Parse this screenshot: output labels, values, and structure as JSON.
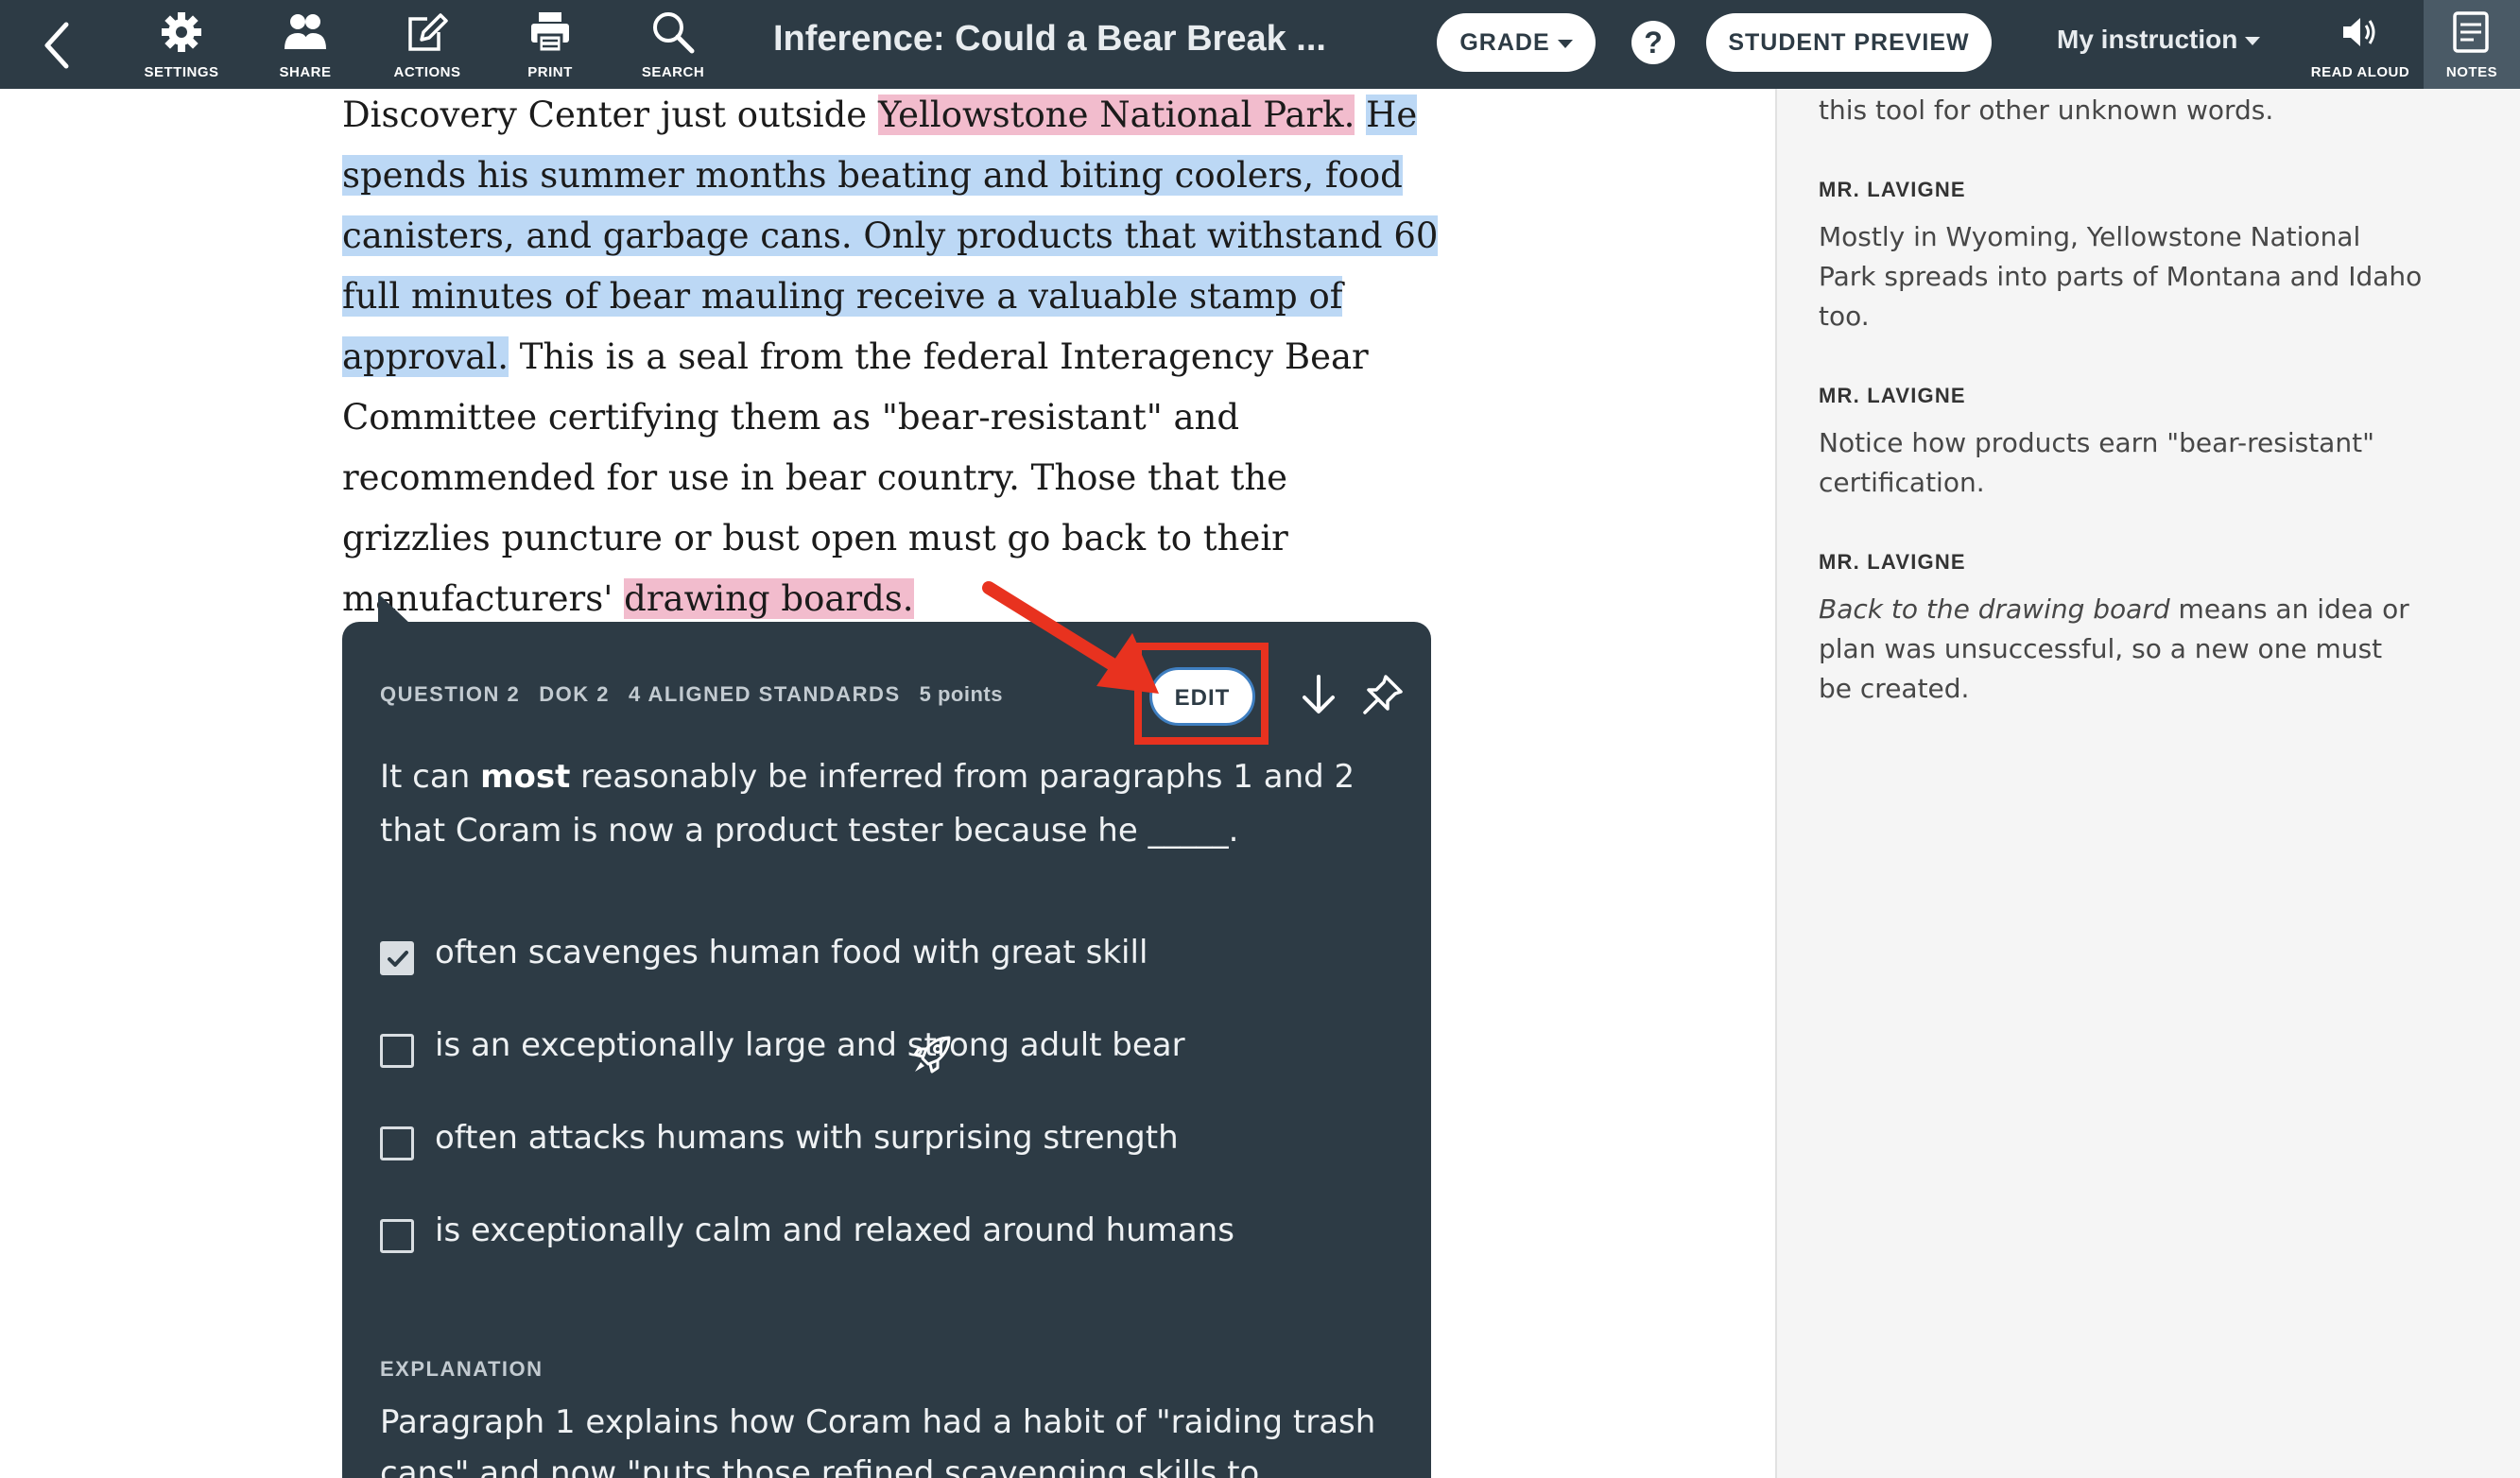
{
  "toolbar": {
    "back_icon": "chevron-left-icon",
    "settings_label": "SETTINGS",
    "share_label": "SHARE",
    "actions_label": "ACTIONS",
    "print_label": "PRINT",
    "search_label": "SEARCH",
    "title": "Inference: Could a Bear Break ...",
    "grade_label": "GRADE",
    "help_label": "?",
    "student_preview_label": "STUDENT PREVIEW",
    "instruction_select": "My instruction",
    "read_aloud_label": "READ ALOUD",
    "notes_label": "NOTES",
    "colors": {
      "bar": "#2d3b45",
      "pill": "#ffffff"
    }
  },
  "reading": {
    "part1": "Discovery Center just outside ",
    "hl1": "Yellowstone National Park.",
    "part2": " ",
    "hl2": "He spends his summer months beating and biting coolers, food canisters, and garbage cans. Only products that withstand 60 full minutes of bear mauling receive a valuable stamp of approval.",
    "part3": " This is a seal from the federal Interagency Bear Committee certifying them as \"bear-resistant\" and recommended for use in bear country. Those that the grizzlies puncture or bust open must go back to their manufacturers' ",
    "hl3": "drawing boards.",
    "highlight_colors": {
      "pink": "#f2bccd",
      "blue": "#bcd8f5"
    }
  },
  "question": {
    "number": "QUESTION 2",
    "dok": "DOK 2",
    "standards": "4 ALIGNED STANDARDS",
    "points": "5 points",
    "edit_label": "EDIT",
    "download_icon": "arrow-down-icon",
    "pin_icon": "pin-icon",
    "prompt_pre": "It can ",
    "prompt_bold": "most",
    "prompt_post": " reasonably be inferred from paragraphs 1 and 2 that Coram is now a product tester because he _____.",
    "choices": [
      {
        "text": "often scavenges human food with great skill",
        "checked": true
      },
      {
        "text": "is an exceptionally large and strong adult bear",
        "checked": false
      },
      {
        "text": "often attacks humans with surprising strength",
        "checked": false
      },
      {
        "text": "is exceptionally calm and relaxed around humans",
        "checked": false
      }
    ],
    "rocket_icon": "rocket-icon",
    "explanation_heading": "EXPLANATION",
    "explanation_text": "Paragraph 1 explains how Coram had a habit of \"raiding trash cans\" and now \"puts those refined scavenging skills to"
  },
  "annotation": {
    "highlight_color": "#e8321f",
    "arrow_icon": "red-arrow-icon"
  },
  "notes": {
    "items": [
      {
        "author": "",
        "text": "this tool for other unknown words."
      },
      {
        "author": "MR. LAVIGNE",
        "text": "Mostly in Wyoming, Yellowstone National Park spreads into parts of Montana and Idaho too."
      },
      {
        "author": "MR. LAVIGNE",
        "text": "Notice how products earn \"bear-resistant\" certification."
      },
      {
        "author": "MR. LAVIGNE",
        "text_italic": "Back to the drawing board",
        "text": " means an idea or plan was unsuccessful, so a new one must be created."
      }
    ]
  }
}
